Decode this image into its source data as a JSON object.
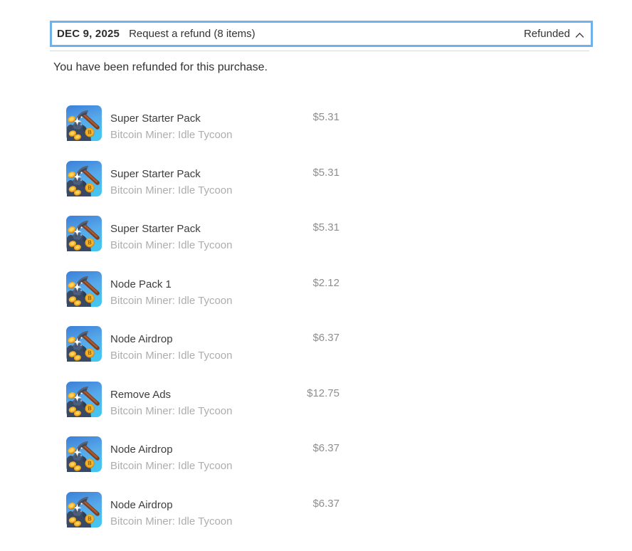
{
  "colors": {
    "focus_border": "#70b1ea",
    "divider": "#d9d9d9",
    "header_text": "#2d2d2d",
    "title_text": "#3d3d3d",
    "subtitle_text": "#adadad",
    "price_text": "#8e8e8e",
    "app_icon_bg_top": "#3b7fd8",
    "app_icon_bg_bottom": "#47c3ef"
  },
  "header": {
    "date": "DEC 9, 2025",
    "title": "Request a refund (8 items)",
    "status": "Refunded",
    "chevron_icon": "chevron-up-icon"
  },
  "message": "You have been refunded for this purchase.",
  "purchases": {
    "app_icon": "bitcoin-miner-pickaxe-icon",
    "items": [
      {
        "title": "Super Starter Pack",
        "app": "Bitcoin Miner: Idle Tycoon",
        "price": "$5.31"
      },
      {
        "title": "Super Starter Pack",
        "app": "Bitcoin Miner: Idle Tycoon",
        "price": "$5.31"
      },
      {
        "title": "Super Starter Pack",
        "app": "Bitcoin Miner: Idle Tycoon",
        "price": "$5.31"
      },
      {
        "title": "Node Pack 1",
        "app": "Bitcoin Miner: Idle Tycoon",
        "price": "$2.12"
      },
      {
        "title": "Node Airdrop",
        "app": "Bitcoin Miner: Idle Tycoon",
        "price": "$6.37"
      },
      {
        "title": "Remove Ads",
        "app": "Bitcoin Miner: Idle Tycoon",
        "price": "$12.75"
      },
      {
        "title": "Node Airdrop",
        "app": "Bitcoin Miner: Idle Tycoon",
        "price": "$6.37"
      },
      {
        "title": "Node Airdrop",
        "app": "Bitcoin Miner: Idle Tycoon",
        "price": "$6.37"
      }
    ]
  }
}
